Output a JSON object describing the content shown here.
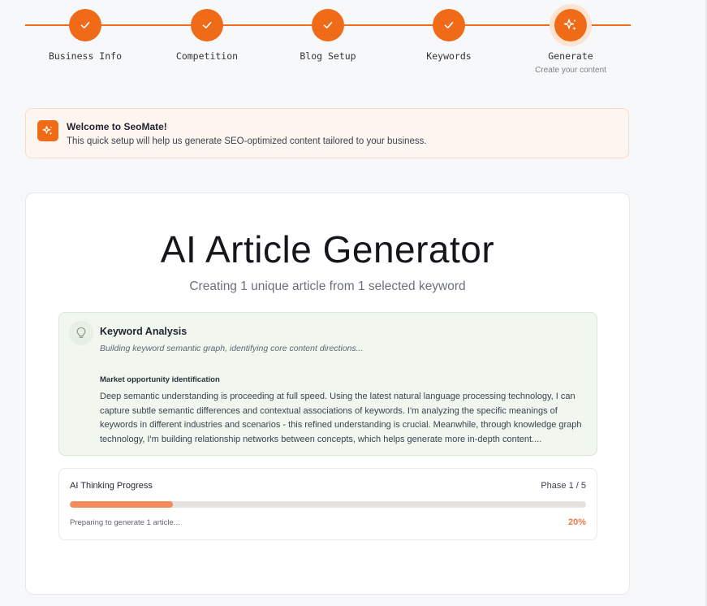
{
  "stepper": {
    "steps": [
      {
        "label": "Business Info",
        "status": "complete",
        "icon": "check-icon"
      },
      {
        "label": "Competition",
        "status": "complete",
        "icon": "check-icon"
      },
      {
        "label": "Blog Setup",
        "status": "complete",
        "icon": "check-icon"
      },
      {
        "label": "Keywords",
        "status": "complete",
        "icon": "check-icon"
      },
      {
        "label": "Generate",
        "sublabel": "Create your content",
        "status": "active",
        "icon": "sparkle-icon"
      }
    ]
  },
  "banner": {
    "title": "Welcome to SeoMate!",
    "text": "This quick setup will help us generate SEO-optimized content tailored to your business.",
    "icon": "sparkle-icon"
  },
  "generator": {
    "title": "AI Article Generator",
    "subtitle": "Creating 1 unique article from 1 selected keyword"
  },
  "analysis": {
    "icon": "lightbulb-icon",
    "title": "Keyword Analysis",
    "subtitle": "Building keyword semantic graph, identifying core content directions...",
    "heading": "Market opportunity identification",
    "body": "Deep semantic understanding is proceeding at full speed. Using the latest natural language processing technology, I can capture subtle semantic differences and contextual associations of keywords. I'm analyzing the specific meanings of keywords in different industries and scenarios - this refined understanding is crucial. Meanwhile, through knowledge graph technology, I'm building relationship networks between concepts, which helps generate more in-depth content...."
  },
  "progress": {
    "title": "AI Thinking Progress",
    "phase": "Phase 1 / 5",
    "status": "Preparing to generate 1 article...",
    "percent_label": "20%",
    "percent": 20
  },
  "colors": {
    "accent": "#f06b18",
    "progress_fill": "#f58a5a",
    "analysis_bg": "#f1f6ee",
    "banner_bg": "#fdf6f0"
  }
}
